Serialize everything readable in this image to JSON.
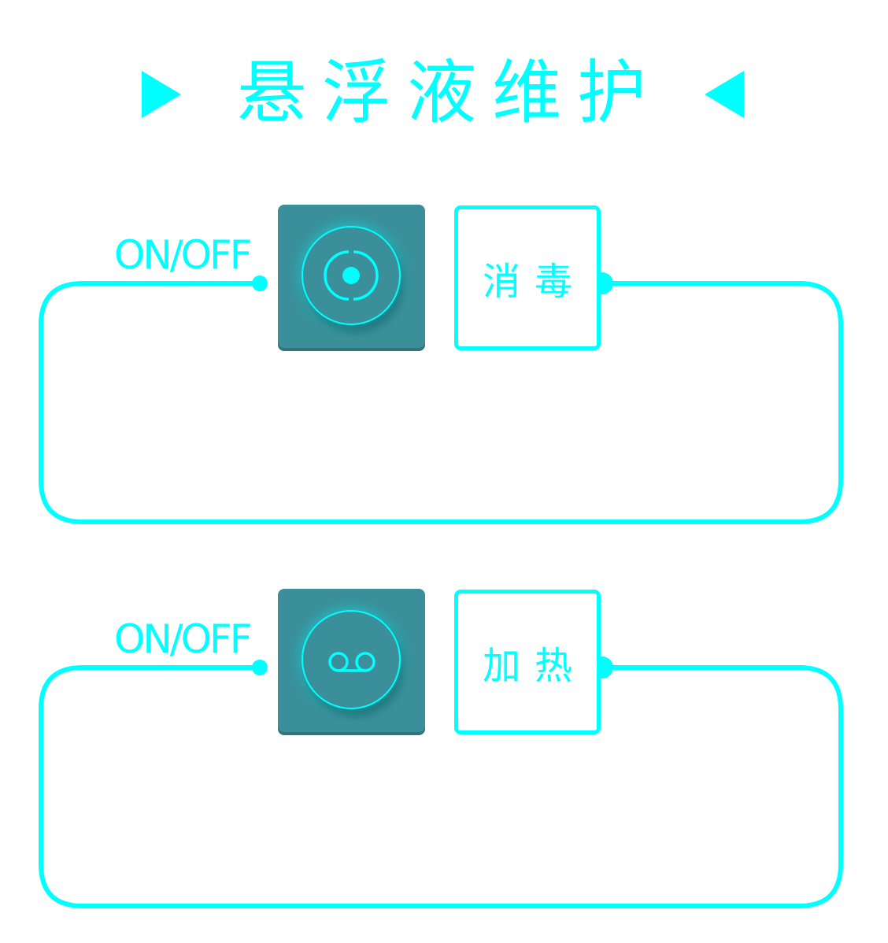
{
  "title": "悬浮液维护",
  "colors": {
    "accent": "#00ffff",
    "tile": "#3a8f9a",
    "background": "#ffffff"
  },
  "controls": [
    {
      "switch_label": "ON/OFF",
      "switch_icon": "target-icon",
      "function_label": "消毒"
    },
    {
      "switch_label": "ON/OFF",
      "switch_icon": "voicemail-icon",
      "function_label": "加热"
    }
  ]
}
